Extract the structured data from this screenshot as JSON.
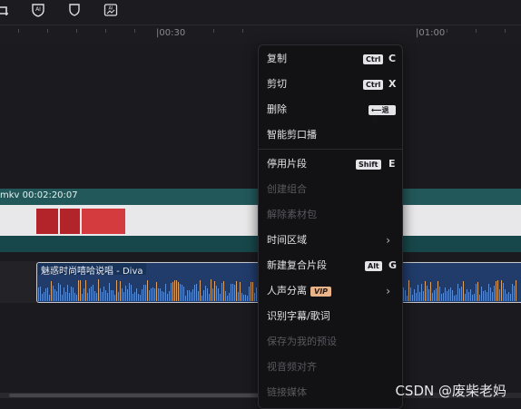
{
  "toolbar": {
    "icons": [
      "crop-icon",
      "ai-shield-icon",
      "shield-icon",
      "ai-image-icon"
    ]
  },
  "ruler": {
    "labels": [
      "|00:30",
      "|01:00"
    ]
  },
  "video_clip": {
    "name": "mkv  00:02:20:07"
  },
  "audio_clip": {
    "title": "魅惑时尚嘻哈说唱 - Diva"
  },
  "context_menu": {
    "copy": {
      "label": "复制",
      "key_mod": "Ctrl",
      "key": "C"
    },
    "cut": {
      "label": "剪切",
      "key_mod": "Ctrl",
      "key": "X"
    },
    "delete": {
      "label": "删除",
      "key_mod": "⟵退格"
    },
    "smart_cut": {
      "label": "智能剪口播"
    },
    "disable_clip": {
      "label": "停用片段",
      "key_mod": "Shift",
      "key": "E"
    },
    "create_group": {
      "label": "创建组合"
    },
    "dissolve_material": {
      "label": "解除素材包"
    },
    "time_range": {
      "label": "时间区域"
    },
    "new_compound": {
      "label": "新建复合片段",
      "key_mod": "Alt",
      "key": "G"
    },
    "vocal_separation": {
      "label": "人声分离",
      "badge": "VIP"
    },
    "recognize_subtitles": {
      "label": "识别字幕/歌词"
    },
    "save_preset": {
      "label": "保存为我的预设"
    },
    "av_align": {
      "label": "视音频对齐"
    },
    "link_media": {
      "label": "链接媒体"
    }
  },
  "watermark": "CSDN @废柴老妈"
}
